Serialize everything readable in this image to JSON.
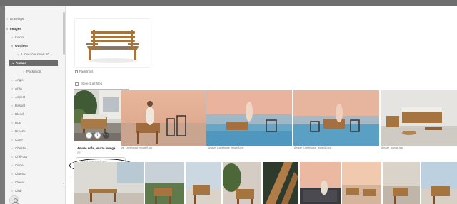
{
  "sidebar": {
    "items": [
      {
        "label": "Drawings",
        "chevron": ">",
        "level": 0,
        "bold": false
      },
      {
        "label": "Images",
        "chevron": "v",
        "level": 0,
        "bold": true
      },
      {
        "label": "Indoor",
        "chevron": ">",
        "level": 1,
        "bold": false
      },
      {
        "label": "Outdoor",
        "chevron": "v",
        "level": 1,
        "bold": true
      },
      {
        "label": "1. Outdoor news 20...",
        "chevron": ">",
        "level": 2,
        "bold": false
      },
      {
        "label": "Amaze",
        "chevron": "v",
        "level": 2,
        "bold": true,
        "selected": true
      },
      {
        "label": "Packshots",
        "chevron": ">",
        "level": 3,
        "bold": false
      },
      {
        "label": "Angle",
        "chevron": ">",
        "level": 2,
        "bold": false
      },
      {
        "label": "Area",
        "chevron": ">",
        "level": 2,
        "bold": false
      },
      {
        "label": "Aspect",
        "chevron": ">",
        "level": 2,
        "bold": false
      },
      {
        "label": "Basket",
        "chevron": ">",
        "level": 2,
        "bold": false
      },
      {
        "label": "Blend",
        "chevron": ">",
        "level": 2,
        "bold": false
      },
      {
        "label": "Box",
        "chevron": ">",
        "level": 2,
        "bold": false
      },
      {
        "label": "Breeze",
        "chevron": ">",
        "level": 2,
        "bold": false
      },
      {
        "label": "Cave",
        "chevron": ">",
        "level": 2,
        "bold": false
      },
      {
        "label": "Chester",
        "chevron": ">",
        "level": 2,
        "bold": false
      },
      {
        "label": "Chill-out",
        "chevron": ">",
        "level": 2,
        "bold": false
      },
      {
        "label": "Circle",
        "chevron": ">",
        "level": 2,
        "bold": false
      },
      {
        "label": "Classic",
        "chevron": ">",
        "level": 2,
        "bold": false
      },
      {
        "label": "Clover",
        "chevron": ">",
        "level": 2,
        "bold": false
      },
      {
        "label": "Club",
        "chevron": ">",
        "level": 2,
        "bold": false
      }
    ]
  },
  "collection": {
    "label": "Packshots"
  },
  "select_all": {
    "label": "Select all files"
  },
  "files_row1": [
    {
      "caption": ""
    },
    {
      "caption": "ze_Lighthouse_model9.jpg"
    },
    {
      "caption": "Amaze_Lighthouse_model8.jpg"
    },
    {
      "caption": "Amaze_Lighthouse_model10.jpg"
    },
    {
      "caption": "Amaze_lounge.jpg"
    }
  ],
  "selected_file": {
    "title": "Amaze sofa_amaze lounge",
    "subtitle": "jpg",
    "download_placeholder": "Select download type",
    "actions": [
      {
        "icon": "download-icon",
        "glyph": "⤓"
      },
      {
        "icon": "share-icon",
        "glyph": "⇪"
      },
      {
        "icon": "more-icon",
        "glyph": "⋯"
      }
    ]
  },
  "colors": {
    "selected_folder_bg": "#6b6b6b",
    "frame": "#6e6e6e",
    "sidebar_bg": "#f4f4f4"
  }
}
